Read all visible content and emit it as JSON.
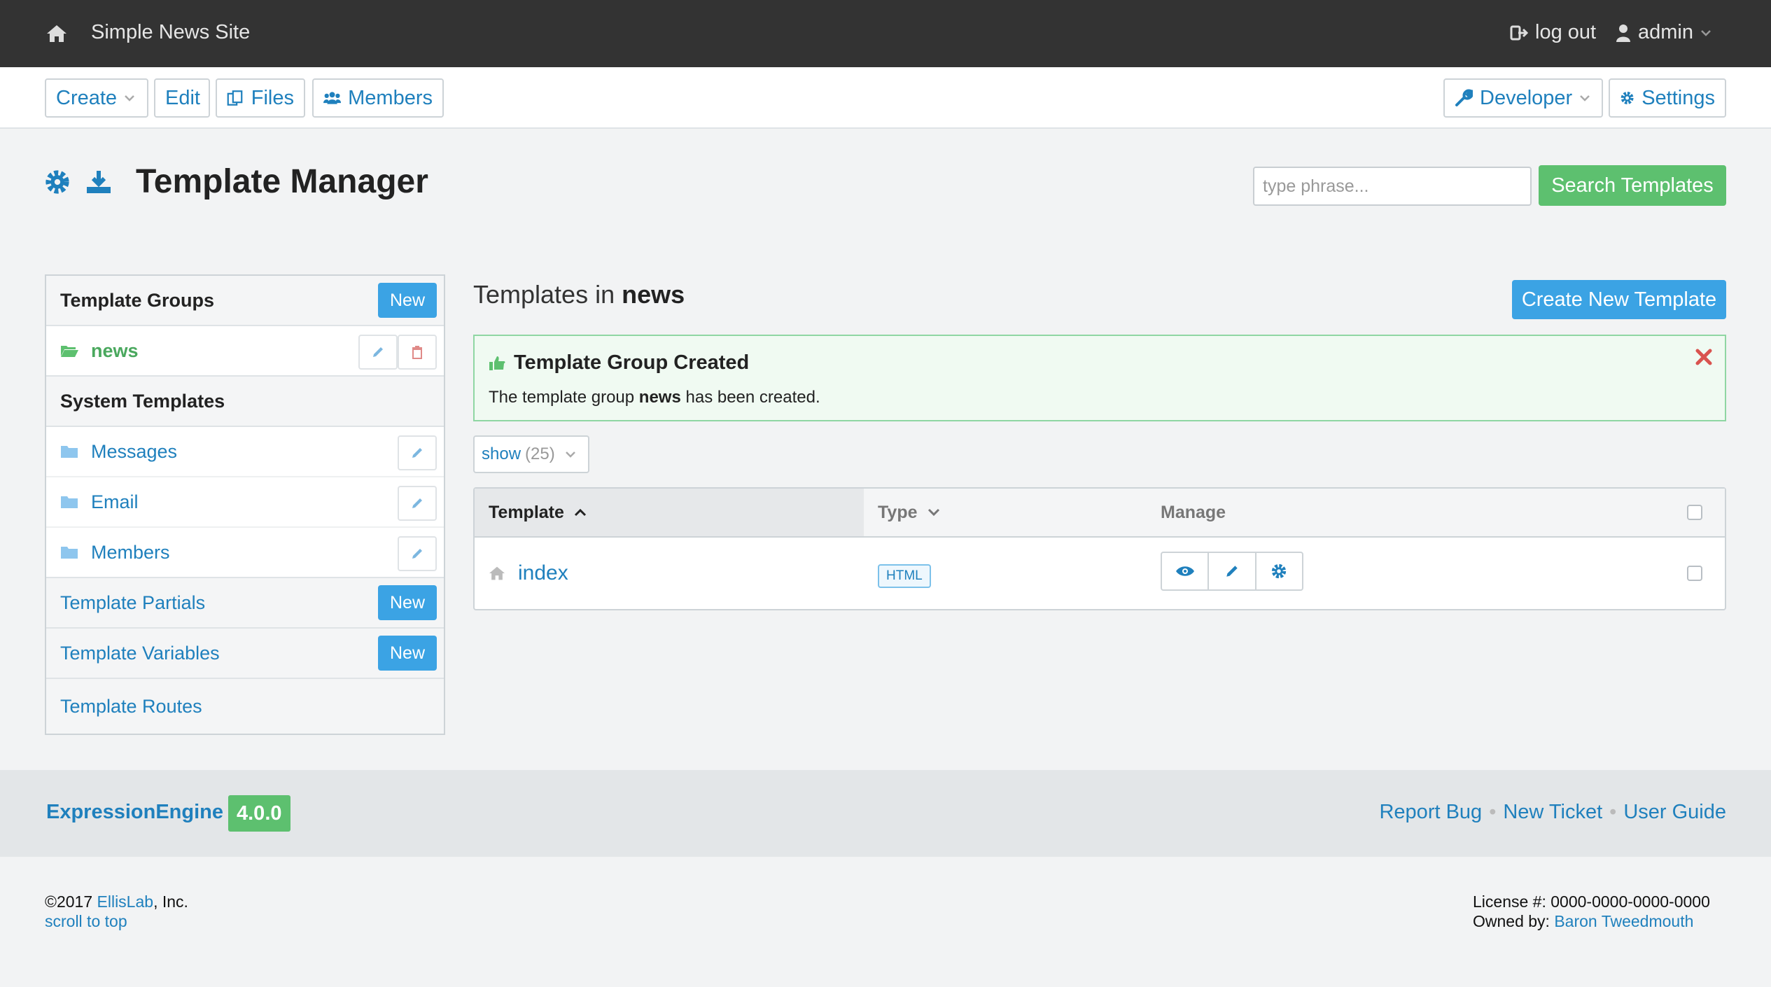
{
  "topbar": {
    "site_name": "Simple News Site",
    "logout_label": "log out",
    "user_label": "admin"
  },
  "nav": {
    "create": "Create",
    "edit": "Edit",
    "files": "Files",
    "members": "Members",
    "developer": "Developer",
    "settings": "Settings"
  },
  "header": {
    "title": "Template Manager",
    "search_placeholder": "type phrase...",
    "search_button": "Search Templates"
  },
  "sidebar": {
    "groups_heading": "Template Groups",
    "new_label": "New",
    "active_group": "news",
    "system_heading": "System Templates",
    "system_items": [
      "Messages",
      "Email",
      "Members"
    ],
    "partials": "Template Partials",
    "variables": "Template Variables",
    "routes": "Template Routes"
  },
  "main": {
    "title_prefix": "Templates in",
    "title_group": "news",
    "create_button": "Create New Template",
    "alert": {
      "title": "Template Group Created",
      "body_prefix": "The template group",
      "body_group": "news",
      "body_suffix": "has been created."
    },
    "show_label": "show",
    "show_count": "(25)",
    "columns": [
      "Template",
      "Type",
      "Manage"
    ],
    "rows": [
      {
        "name": "index",
        "type": "HTML"
      }
    ]
  },
  "footer": {
    "product": "ExpressionEngine",
    "version": "4.0.0",
    "links": [
      "Report Bug",
      "New Ticket",
      "User Guide"
    ],
    "copyright_prefix": "©2017",
    "company": "EllisLab",
    "copyright_suffix": ", Inc.",
    "scroll_top": "scroll to top",
    "license": "License #: 0000-0000-0000-0000",
    "owned_by_prefix": "Owned by:",
    "owner": "Baron Tweedmouth"
  },
  "colors": {
    "topbar_bg": "#333333",
    "link": "#1f80bd",
    "primary_button": "#3ba3e4",
    "success": "#5dc06f",
    "danger": "#d9534f"
  },
  "icons": [
    "home-icon",
    "logout-icon",
    "user-icon",
    "chevron-down-icon",
    "files-icon",
    "members-icon",
    "wrench-icon",
    "gear-icon",
    "download-icon",
    "folder-open-icon",
    "folder-icon",
    "pencil-icon",
    "trash-icon",
    "thumbs-up-icon",
    "close-icon",
    "sort-up-icon",
    "eye-icon"
  ]
}
